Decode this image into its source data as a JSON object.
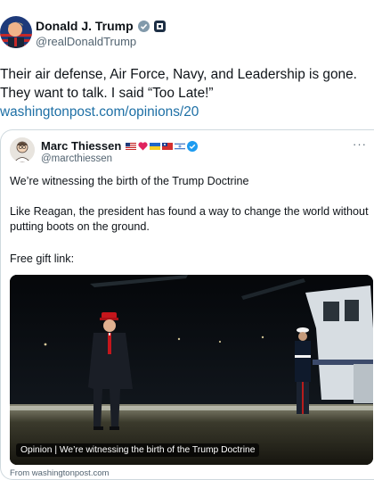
{
  "post": {
    "author_name": "Donald J. Trump",
    "author_handle": "@realDonaldTrump",
    "text": "Their air defense, Air Force, Navy, and Leadership is gone. They want to talk. I said “Too Late!”",
    "link": "washingtonpost.com/opinions/20"
  },
  "quoted": {
    "author_name": "Marc Thiessen",
    "author_handle": "@marcthiessen",
    "more_label": "···",
    "paragraph1": "We’re witnessing the birth of the Trump Doctrine",
    "paragraph2": "Like Reagan, the president has found a way to change the world without putting boots on the ground.",
    "paragraph3": "Free gift link:",
    "card": {
      "caption": "Opinion | We’re witnessing the birth of the Trump Doctrine",
      "source": "From washingtonpost.com"
    }
  },
  "icons": {
    "main_avatar": "trump-avatar-icon",
    "gray_badge": "gray-verified-icon",
    "gov_badge": "affiliate-badge-icon",
    "verified": "blue-check-icon"
  },
  "colors": {
    "link": "#1d6fa5",
    "verified_blue": "#1d9bf0",
    "text": "#0f1419",
    "secondary": "#536471"
  }
}
